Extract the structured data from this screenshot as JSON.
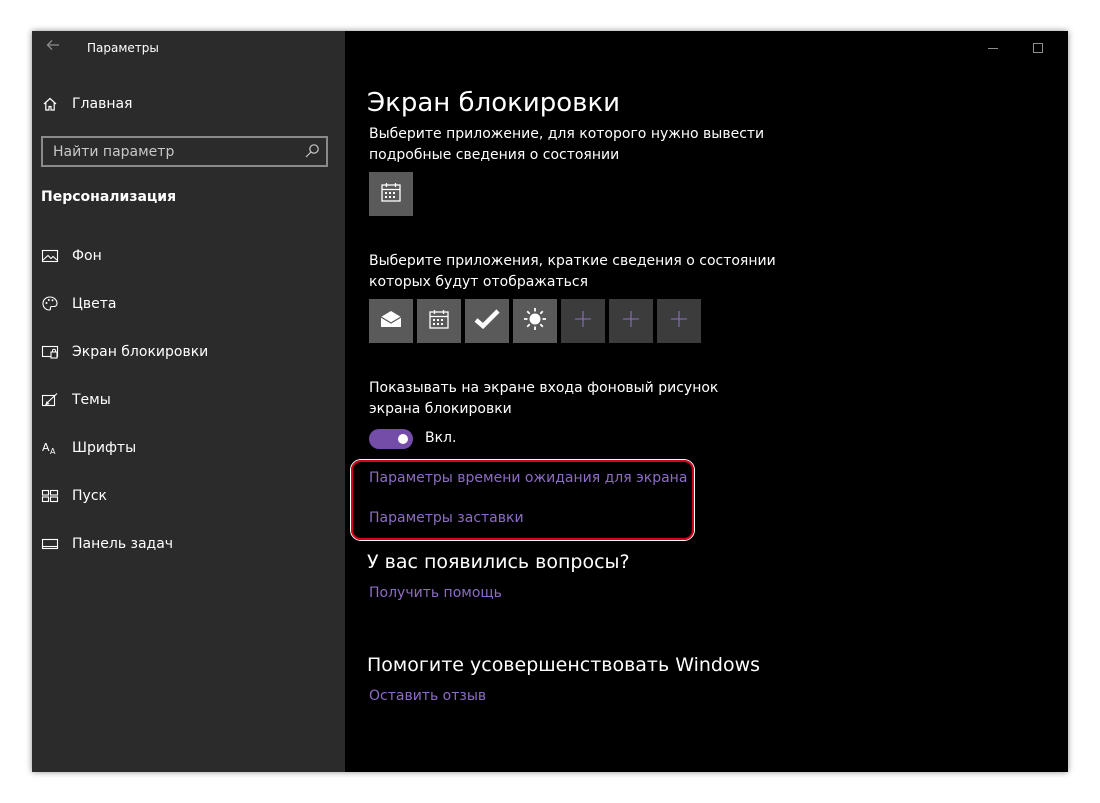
{
  "window": {
    "title": "Параметры",
    "controls": {
      "minimize": "minimize-icon",
      "maximize": "maximize-icon",
      "close": "close-icon"
    }
  },
  "sidebar": {
    "home_label": "Главная",
    "search_placeholder": "Найти параметр",
    "section_title": "Персонализация",
    "items": [
      {
        "label": "Фон",
        "icon": "picture-icon"
      },
      {
        "label": "Цвета",
        "icon": "palette-icon"
      },
      {
        "label": "Экран блокировки",
        "icon": "lock-screen-icon"
      },
      {
        "label": "Темы",
        "icon": "themes-icon"
      },
      {
        "label": "Шрифты",
        "icon": "fonts-icon"
      },
      {
        "label": "Пуск",
        "icon": "start-icon"
      },
      {
        "label": "Панель задач",
        "icon": "taskbar-icon"
      }
    ]
  },
  "main": {
    "title": "Экран блокировки",
    "detailed_status_text": "Выберите приложение, для которого нужно вывести подробные сведения о состоянии",
    "detailed_status_app": "calendar-icon",
    "quick_status_text": "Выберите приложения, краткие сведения о состоянии которых будут отображаться",
    "quick_status_apps": [
      "mail-icon",
      "calendar-icon",
      "checkmark-icon",
      "weather-sun-icon",
      "plus-icon",
      "plus-icon",
      "plus-icon"
    ],
    "signin_bg_text": "Показывать на экране входа фоновый рисунок экрана блокировки",
    "toggle_state": "Вкл.",
    "toggle_on": true,
    "links": {
      "screen_timeout": "Параметры времени ожидания для экрана",
      "screensaver": "Параметры заставки"
    },
    "questions": {
      "heading": "У вас появились вопросы?",
      "link": "Получить помощь"
    },
    "improve": {
      "heading": "Помогите усовершенствовать Windows",
      "link": "Оставить отзыв"
    }
  },
  "colors": {
    "accent": "#744da9",
    "link": "#8c6cc4",
    "highlight_frame": "#d6001c",
    "sidebar_bg": "#2b2b2b",
    "main_bg": "#000000"
  }
}
